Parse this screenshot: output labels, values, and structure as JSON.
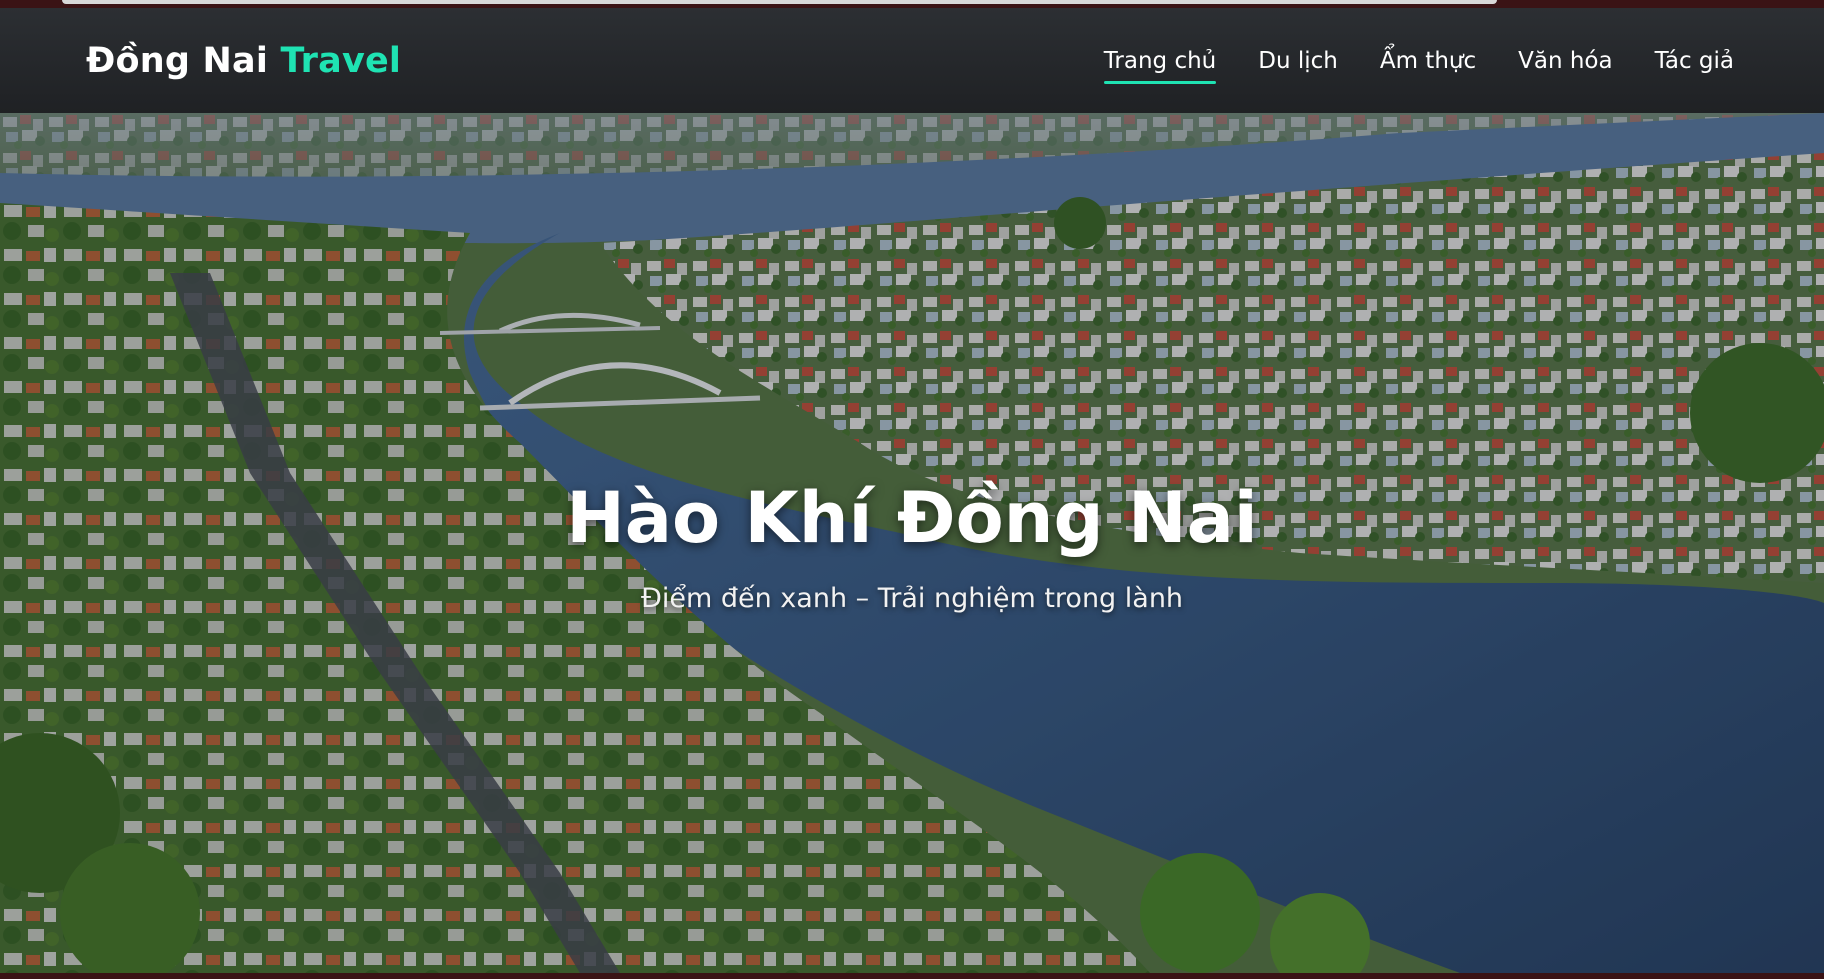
{
  "brand": {
    "name": "Đồng Nai",
    "accent": "Travel",
    "accent_color": "#1fe3b3"
  },
  "nav": {
    "items": [
      {
        "label": "Trang chủ",
        "active": true
      },
      {
        "label": "Du lịch",
        "active": false
      },
      {
        "label": "Ẩm thực",
        "active": false
      },
      {
        "label": "Văn hóa",
        "active": false
      },
      {
        "label": "Tác giả",
        "active": false
      }
    ]
  },
  "hero": {
    "title": "Hào Khí Đồng Nai",
    "subtitle": "Điểm đến xanh – Trải nghiệm trong lành",
    "image": "aerial-river-city-photo"
  },
  "colors": {
    "navbar_bg": "#25282b",
    "text": "#ffffff",
    "accent": "#1fe3b3",
    "frame": "#3a1315"
  }
}
